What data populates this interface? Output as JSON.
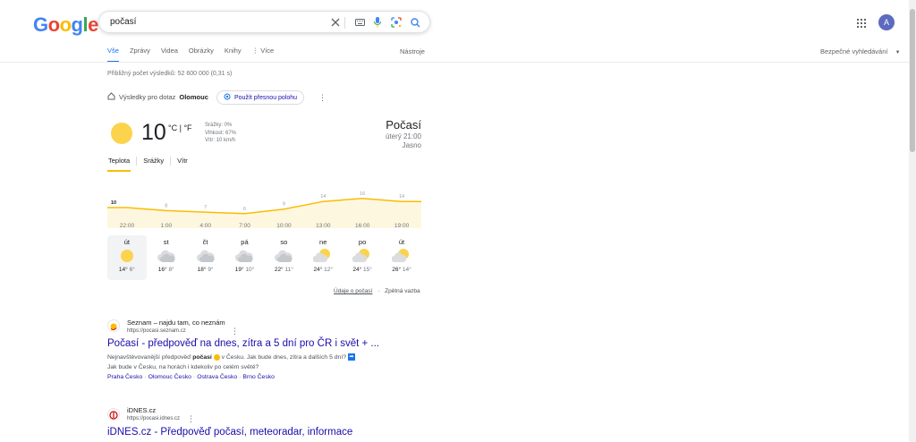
{
  "header": {
    "logo": [
      "G",
      "o",
      "o",
      "g",
      "l",
      "e"
    ],
    "query": "počasí",
    "avatar_letter": "A"
  },
  "tabs": [
    {
      "label": "Vše",
      "active": true
    },
    {
      "label": "Zprávy"
    },
    {
      "label": "Videa"
    },
    {
      "label": "Obrázky"
    },
    {
      "label": "Knihy"
    },
    {
      "label": "⋮ Více"
    }
  ],
  "tools_label": "Nástroje",
  "safe_search_label": "Bezpečné vyhledávání",
  "result_count": "Přibližný počet výsledků: 52 600 000 (0,31 s)",
  "location": {
    "prefix": "Výsledky pro dotaz",
    "city": "Olomouc",
    "precise_button": "Použít přesnou polohu"
  },
  "weather": {
    "temp": "10",
    "units": "°C | °F",
    "precip": "Srážky: 0%",
    "humidity": "Vlhkost: 67%",
    "wind": "Vítr: 10 km/h",
    "title": "Počasí",
    "time": "úterý 21:00",
    "condition": "Jasno",
    "tabs": [
      "Teplota",
      "Srážky",
      "Vítr"
    ],
    "footer_link": "Údaje o počasí",
    "footer_feedback": "Zpětná vazba"
  },
  "chart_data": {
    "type": "area",
    "x": [
      "22:00",
      "1:00",
      "4:00",
      "7:00",
      "10:00",
      "13:00",
      "16:00",
      "19:00"
    ],
    "values": [
      10,
      8,
      7,
      6,
      9,
      14,
      16,
      14
    ],
    "value_labels": [
      "10",
      "8",
      "7",
      "6",
      "9",
      "14",
      "16",
      "14"
    ],
    "color": "#fbbc04"
  },
  "forecast": [
    {
      "day": "út",
      "hi": "14",
      "lo": "6",
      "icon": "sun-icon",
      "selected": true
    },
    {
      "day": "st",
      "hi": "16",
      "lo": "8",
      "icon": "cloud-icon"
    },
    {
      "day": "čt",
      "hi": "18",
      "lo": "9",
      "icon": "cloud-icon"
    },
    {
      "day": "pá",
      "hi": "19",
      "lo": "10",
      "icon": "cloud-icon"
    },
    {
      "day": "so",
      "hi": "22",
      "lo": "11",
      "icon": "cloud-icon"
    },
    {
      "day": "ne",
      "hi": "24",
      "lo": "12",
      "icon": "partly-cloudy-icon"
    },
    {
      "day": "po",
      "hi": "24",
      "lo": "15",
      "icon": "partly-cloudy-icon"
    },
    {
      "day": "út",
      "hi": "26",
      "lo": "14",
      "icon": "partly-cloudy-icon"
    }
  ],
  "results": [
    {
      "site": "Seznam – najdu tam, co neznám",
      "url": "https://pocasi.seznam.cz",
      "title": "Počasí - předpověď na dnes, zítra a 5 dní pro ČR i svět + ...",
      "snippet_a": "Nejnavštěvovanější předpověď ",
      "snippet_b": "počasí",
      "snippet_c": " v Česku. Jak bude dnes, zítra a dalších 5 dní?",
      "snippet_d": "Jak bude v Česku, na horách i kdekoliv po celém světě?",
      "links": [
        "Praha Česko",
        "Olomouc Česko",
        "Ostrava Česko",
        "Brno Česko"
      ]
    },
    {
      "site": "iDNES.cz",
      "url": "https://pocasi.idnes.cz",
      "title": "iDNES.cz - Předpověď počasí, meteoradar, informace"
    }
  ]
}
